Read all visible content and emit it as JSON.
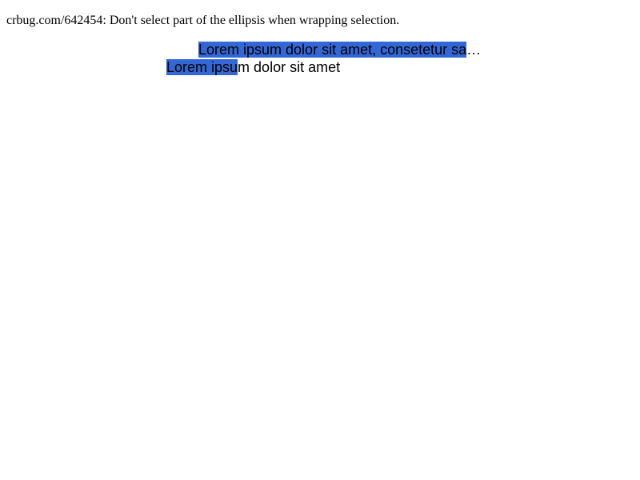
{
  "description": "crbug.com/642454: Don't select part of the ellipsis when wrapping selection.",
  "lines": [
    {
      "selected_text": "Lorem ipsum dolor sit amet, consetetur sa",
      "unselected_text": "…"
    },
    {
      "selected_text": "Lorem ipsu",
      "unselected_text": "m dolor sit amet"
    }
  ],
  "colors": {
    "selection": "#3367d6",
    "text": "#000000",
    "background": "#ffffff"
  }
}
